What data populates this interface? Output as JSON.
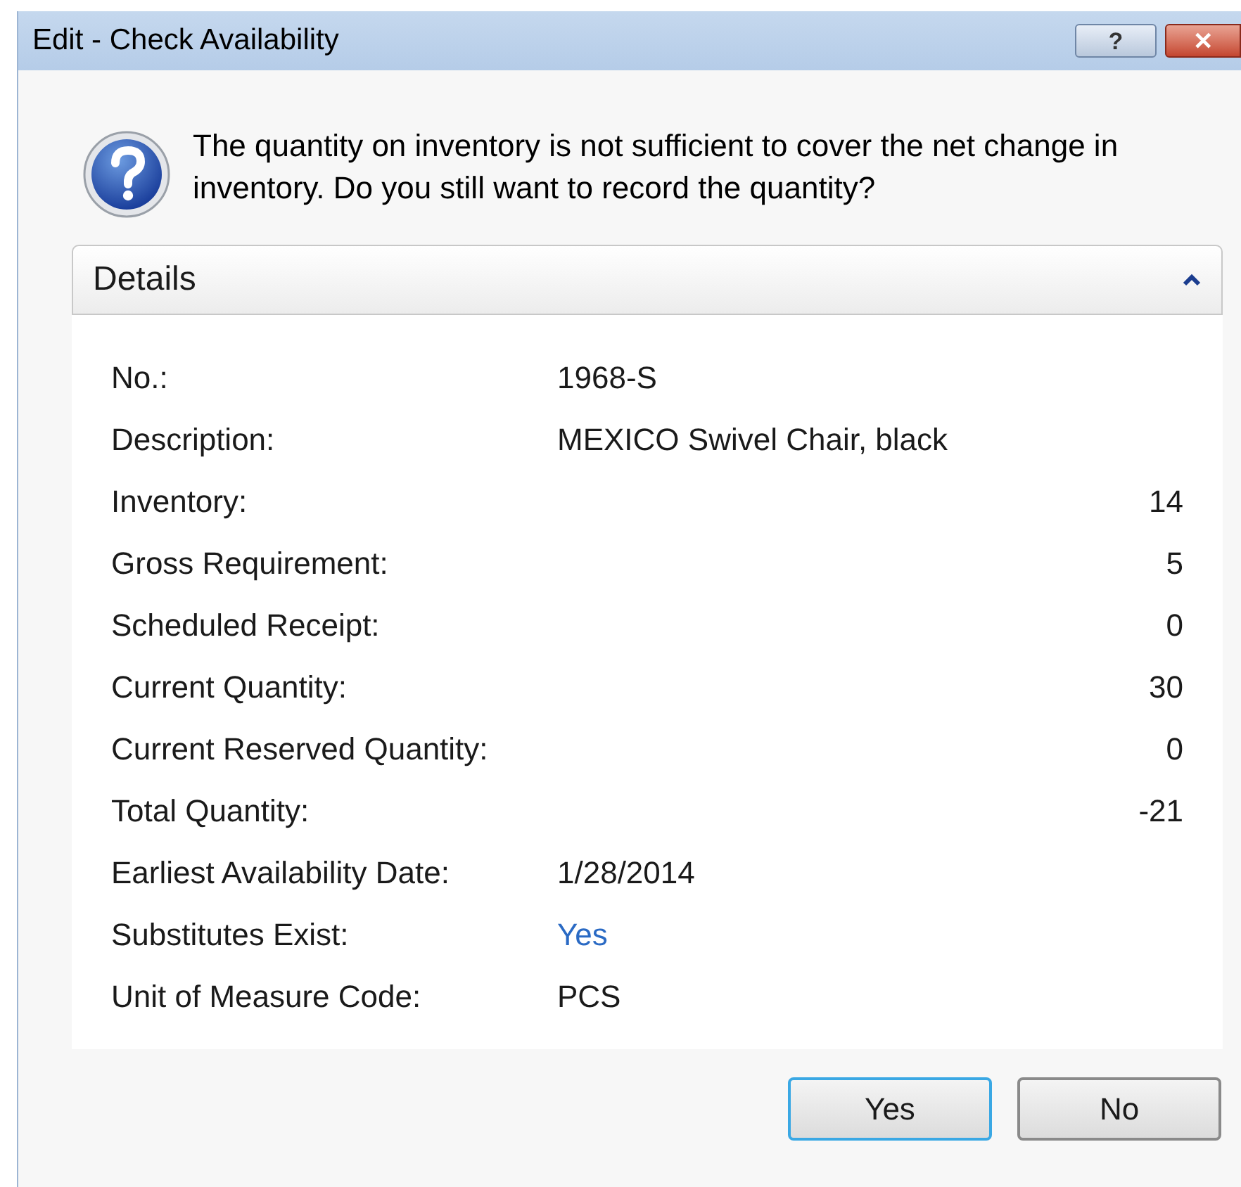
{
  "window": {
    "title": "Edit - Check Availability",
    "help_button": "?",
    "close_button": "✕"
  },
  "message": "The quantity on inventory is not sufficient to cover the net change in inventory. Do you still want to record the quantity?",
  "details": {
    "title": "Details",
    "expanded": true,
    "fields": [
      {
        "label": "No.:",
        "value": "1968-S",
        "kind": "text"
      },
      {
        "label": "Description:",
        "value": "MEXICO Swivel Chair, black",
        "kind": "text"
      },
      {
        "label": "Inventory:",
        "value": "14",
        "kind": "number"
      },
      {
        "label": "Gross Requirement:",
        "value": "5",
        "kind": "number"
      },
      {
        "label": "Scheduled Receipt:",
        "value": "0",
        "kind": "number"
      },
      {
        "label": "Current Quantity:",
        "value": "30",
        "kind": "number"
      },
      {
        "label": "Current Reserved Quantity:",
        "value": "0",
        "kind": "number"
      },
      {
        "label": "Total Quantity:",
        "value": "-21",
        "kind": "number"
      },
      {
        "label": "Earliest Availability Date:",
        "value": "1/28/2014",
        "kind": "text"
      },
      {
        "label": "Substitutes Exist:",
        "value": "Yes",
        "kind": "link"
      },
      {
        "label": "Unit of Measure Code:",
        "value": "PCS",
        "kind": "text"
      }
    ]
  },
  "buttons": [
    {
      "label": "Yes",
      "default": true
    },
    {
      "label": "No",
      "default": false
    }
  ]
}
